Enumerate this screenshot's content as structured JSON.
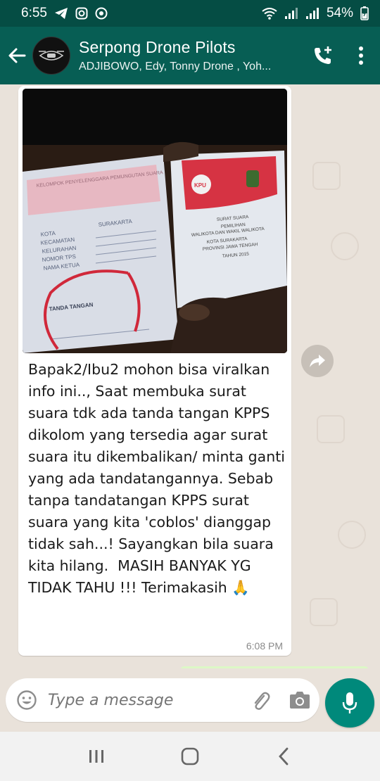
{
  "status_bar": {
    "time": "6:55",
    "battery": "54%"
  },
  "header": {
    "title": "Serpong Drone Pilots",
    "subtitle": "ADJIBOWO, Edy, Tonny Drone , Yoh..."
  },
  "message": {
    "image": {
      "left_page": {
        "heading": "KELOMPOK PENYELENGGARA PEMUNGUTAN SUARA",
        "fields": [
          "KOTA",
          "KECAMATAN",
          "KELURAHAN",
          "NOMOR TPS",
          "NAMA KETUA"
        ],
        "kota_value": "SURAKARTA",
        "signature_label": "TANDA TANGAN"
      },
      "right_page": {
        "logo_label": "KPU",
        "lines": [
          "SURAT SUARA",
          "PEMILIHAN",
          "WALIKOTA DAN WAKIL WALIKOTA",
          "KOTA SURAKARTA",
          "PROVINSI JAWA TENGAH",
          "TAHUN 2015"
        ]
      }
    },
    "text": "Bapak2/Ibu2 mohon bisa viralkan info ini.., Saat membuka surat suara tdk ada tanda tangan KPPS dikolom yang tersedia agar surat suara itu dikembalikan/ minta ganti yang ada tandatangannya. Sebab tanpa tandatangan KPPS surat suara yang kita 'coblos' dianggap tidak sah...! Sayangkan bila suara kita hilang.  MASIH BANYAK YG TIDAK TAHU !!! Terimakasih 🙏",
    "time": "6:08 PM"
  },
  "input": {
    "placeholder": "Type a message"
  },
  "icons": {
    "back": "arrow-left-icon",
    "add_call": "add-call-icon",
    "menu": "more-vert-icon",
    "forward": "forward-icon",
    "emoji": "emoji-icon",
    "attach": "paperclip-icon",
    "camera": "camera-icon",
    "mic": "mic-icon"
  },
  "colors": {
    "status_bar": "#054d44",
    "header": "#075e54",
    "accent": "#00897b",
    "chat_bg": "#e9e2da",
    "outgoing_bubble": "#dcf8c6"
  }
}
